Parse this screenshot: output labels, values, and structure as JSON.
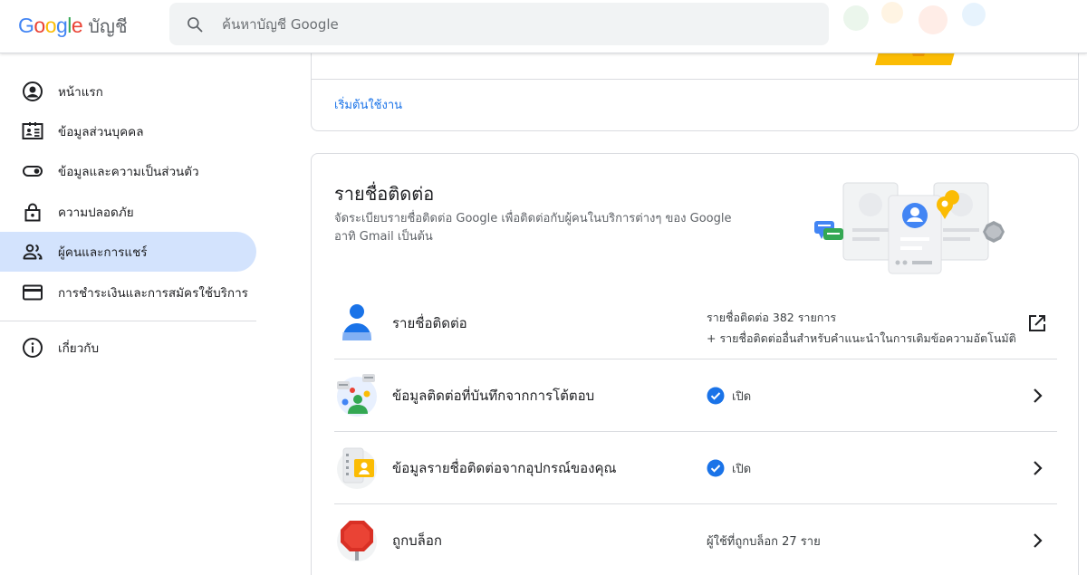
{
  "header": {
    "logo_text": "Google",
    "product_name": "บัญชี",
    "search_placeholder": "ค้นหาบัญชี Google"
  },
  "sidebar": {
    "items": [
      {
        "label": "หน้าแรก",
        "icon": "account-circle-icon",
        "active": false
      },
      {
        "label": "ข้อมูลส่วนบุคคล",
        "icon": "id-card-icon",
        "active": false
      },
      {
        "label": "ข้อมูลและความเป็นส่วนตัว",
        "icon": "toggle-icon",
        "active": false
      },
      {
        "label": "ความปลอดภัย",
        "icon": "lock-icon",
        "active": false
      },
      {
        "label": "ผู้คนและการแชร์",
        "icon": "people-icon",
        "active": true
      },
      {
        "label": "การชำระเงินและการสมัครใช้บริการ",
        "icon": "credit-card-icon",
        "active": false
      },
      {
        "label": "เกี่ยวกับ",
        "icon": "info-icon",
        "active": false
      }
    ]
  },
  "top_card": {
    "link_label": "เริ่มต้นใช้งาน"
  },
  "contacts_card": {
    "title": "รายชื่อติดต่อ",
    "description": "จัดระเบียบรายชื่อติดต่อ Google เพื่อติดต่อกับผู้คนในบริการต่างๆ ของ Google อาทิ Gmail เป็นต้น",
    "rows": [
      {
        "label": "รายชื่อติดต่อ",
        "icon": "contact-person-icon",
        "status_line1": "รายชื่อติดต่อ 382 รายการ",
        "status_line2": "+ รายชื่อติดต่ออื่นสำหรับคำแนะนำในการเติมข้อความอัตโนมัติ",
        "action_icon": "open-in-new-icon"
      },
      {
        "label": "ข้อมูลติดต่อที่บันทึกจากการโต้ตอบ",
        "icon": "interactions-icon",
        "status": "เปิด",
        "status_icon": "check-circle-icon",
        "action_icon": "chevron-right-icon"
      },
      {
        "label": "ข้อมูลรายชื่อติดต่อจากอุปกรณ์ของคุณ",
        "icon": "device-contacts-icon",
        "status": "เปิด",
        "status_icon": "check-circle-icon",
        "action_icon": "chevron-right-icon"
      },
      {
        "label": "ถูกบล็อก",
        "icon": "stop-sign-icon",
        "status": "ผู้ใช้ที่ถูกบล็อก 27 ราย",
        "action_icon": "chevron-right-icon"
      }
    ]
  },
  "colors": {
    "accent_blue": "#1a73e8",
    "active_nav_bg": "#d3e3fd",
    "divider": "#dadce0"
  }
}
